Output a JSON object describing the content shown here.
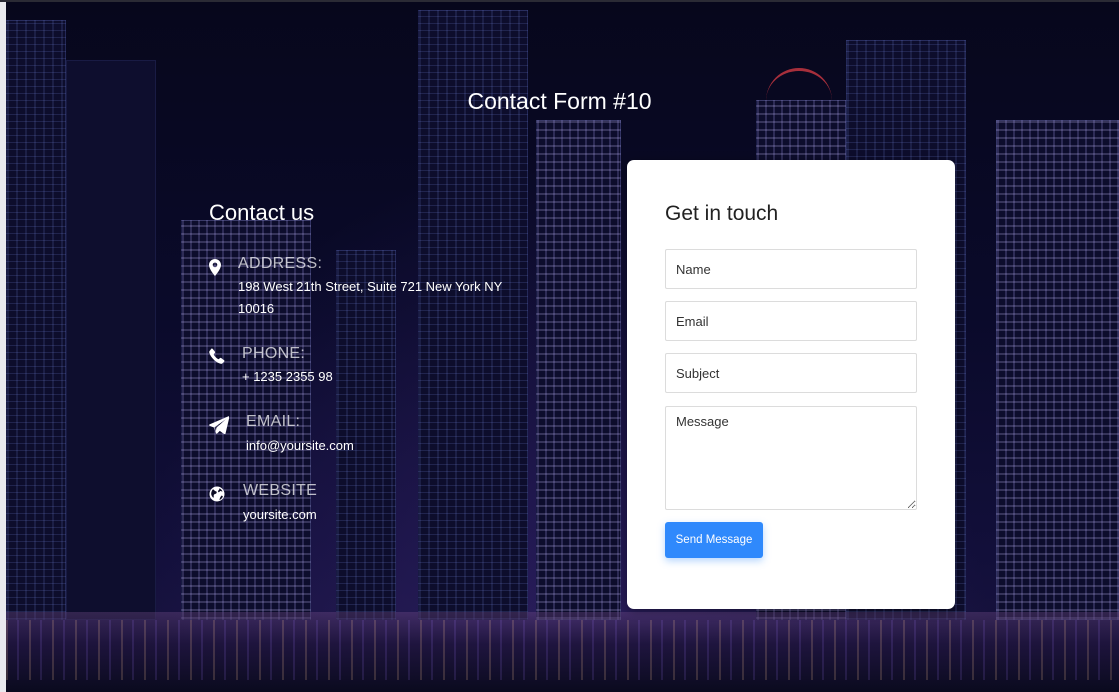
{
  "page": {
    "title": "Contact Form #10"
  },
  "contact": {
    "heading": "Contact us",
    "items": [
      {
        "icon": "map-marker-icon",
        "label": "ADDRESS:",
        "value_line1": "198 West 21th Street, Suite 721 New York NY",
        "value_line2": "10016"
      },
      {
        "icon": "phone-icon",
        "label": "PHONE:",
        "value_line1": "+ 1235 2355 98"
      },
      {
        "icon": "paper-plane-icon",
        "label": "EMAIL:",
        "value_line1": "info@yoursite.com"
      },
      {
        "icon": "globe-icon",
        "label": "WEBSITE",
        "value_line1": "yoursite.com"
      }
    ]
  },
  "form": {
    "title": "Get in touch",
    "name_placeholder": "Name",
    "email_placeholder": "Email",
    "subject_placeholder": "Subject",
    "message_placeholder": "Message",
    "submit_label": "Send Message"
  },
  "colors": {
    "accent": "#2f89fc",
    "background": "#0a0a2a",
    "card": "#ffffff"
  }
}
